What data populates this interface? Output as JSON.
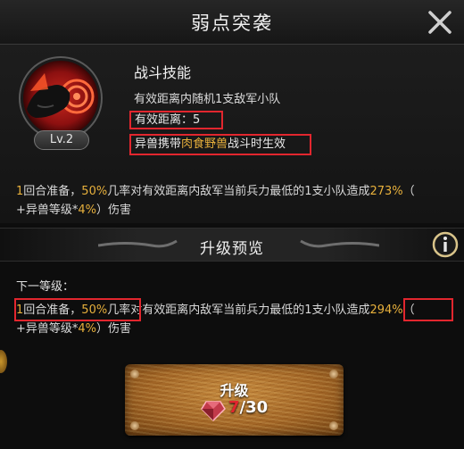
{
  "dialog": {
    "title": "弱点突袭"
  },
  "skill": {
    "level": "Lv.2",
    "name": "战斗技能",
    "target": "有效距离内随机1支敌军小队",
    "range_label": "有效距离：",
    "range_value": "5",
    "beast_prefix": "异兽携带",
    "beast_name": "肉食野兽",
    "beast_suffix": "战斗时生效"
  },
  "effect": {
    "prep_rounds": "1",
    "prep_text": "回合准备，",
    "chance": "50%",
    "middle_text": "几率对有效距离内敌军当前兵力最低的1支小队造成",
    "damage": "273%",
    "paren_open": "（",
    "level_bonus_prefix": "+异兽等级*",
    "level_bonus": "4%",
    "level_bonus_suffix": "）伤害"
  },
  "upgrade_preview": {
    "title": "升级预览",
    "next_level_label": "下一等级：",
    "prep_rounds": "1",
    "prep_text": "回合准备，",
    "chance": "50%",
    "middle_text": "几率对有效距离内敌军当前兵力最低的1支小队造成",
    "damage": "294%",
    "paren_open": "（",
    "level_bonus_prefix": "+异兽等级*",
    "level_bonus": "4%",
    "level_bonus_suffix": "）伤害"
  },
  "upgrade_button": {
    "label": "升级",
    "cost_current": "7",
    "cost_required": "/30"
  },
  "icons": {
    "close": "close-icon",
    "info": "info-icon",
    "skill": "beast-skill-icon",
    "gem": "gem-icon"
  },
  "colors": {
    "highlight": "#e7b03c",
    "annotation_box": "#e2262e",
    "cost_insufficient": "#e2262e"
  }
}
